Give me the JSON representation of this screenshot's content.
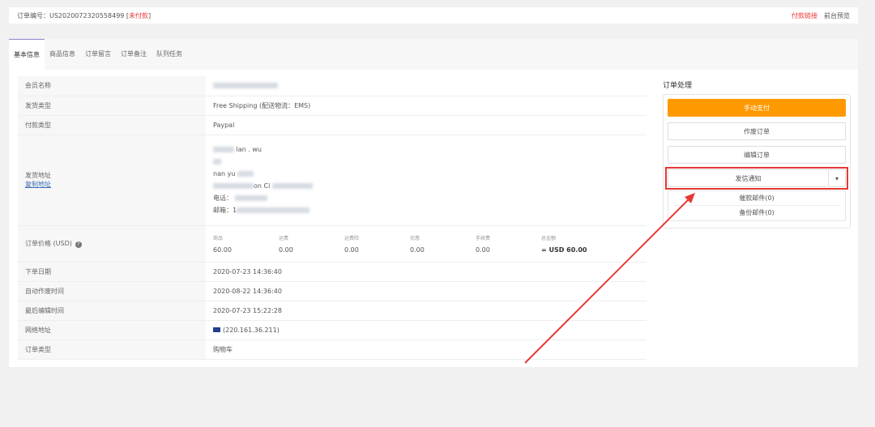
{
  "header": {
    "order_label": "订单编号：",
    "order_no": "US2020072320558499",
    "status": "未付款",
    "payment_link": "付款链接",
    "preview": "前台预览"
  },
  "tabs": [
    "基本信息",
    "商品信息",
    "订单留言",
    "订单备注",
    "队列任务"
  ],
  "info": {
    "member_label": "会员名称",
    "ship_type_label": "发货类型",
    "ship_type": "Free Shipping (配送物流：EMS)",
    "pay_type_label": "付款类型",
    "pay_type": "Paypal",
    "address_label": "发货地址",
    "copy_address": "复制地址",
    "address_lines": [
      "lan . wu",
      "",
      "nan yu",
      "on Ci",
      "电话：",
      "邮箱：1"
    ],
    "price_label": "订单价格 (USD)",
    "price_cols": [
      {
        "l": "商品",
        "v": "60.00"
      },
      {
        "l": "运费",
        "v": "0.00"
      },
      {
        "l": "运费险",
        "v": "0.00"
      },
      {
        "l": "优惠",
        "v": "0.00"
      },
      {
        "l": "手续费",
        "v": "0.00"
      },
      {
        "l": "总金额",
        "v": "= USD 60.00"
      }
    ],
    "order_date_label": "下单日期",
    "order_date": "2020-07-23 14:36:40",
    "auto_void_label": "自动作废时间",
    "auto_void": "2020-08-22 14:36:40",
    "last_edit_label": "最后编辑时间",
    "last_edit": "2020-07-23 15:22:28",
    "ip_label": "网络地址",
    "ip": "(220.161.36.211)",
    "order_type_label": "订单类型",
    "order_type": "购物车"
  },
  "side": {
    "title": "订单处理",
    "manual_pay": "手动支付",
    "void": "作废订单",
    "edit": "编辑订单",
    "notify": "发信通知",
    "reminder": "催款邮件(0)",
    "backup": "备份邮件(0)"
  },
  "colors": {
    "accent": "#ff9900",
    "highlight": "#e53935"
  }
}
